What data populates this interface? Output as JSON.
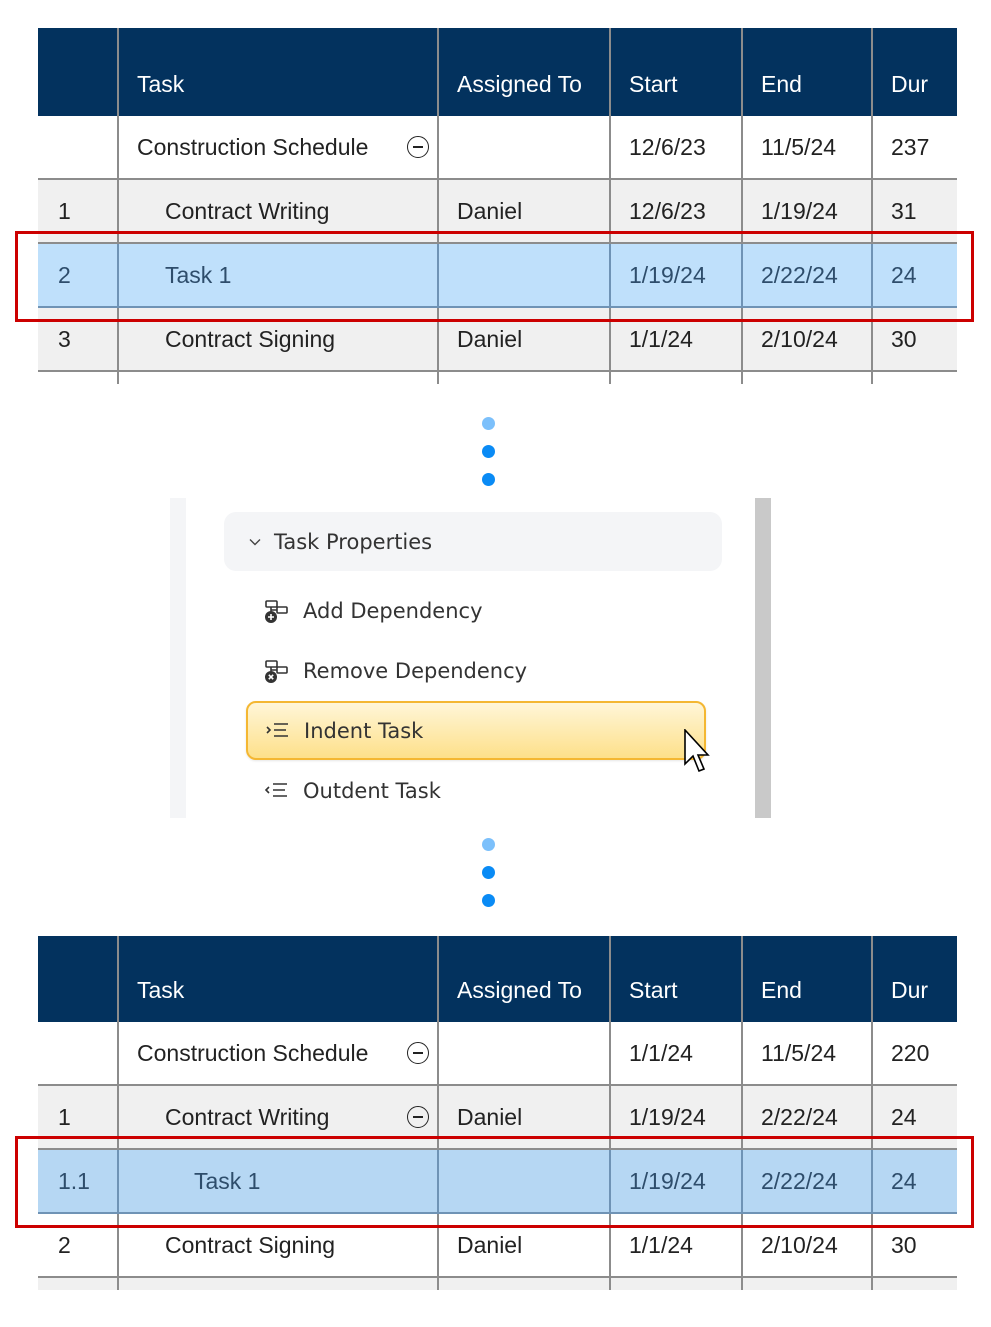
{
  "before": {
    "columns": [
      "",
      "Task",
      "Assigned To",
      "Start",
      "End",
      "Dur"
    ],
    "rows": [
      {
        "id": "",
        "task": "Construction Schedule",
        "assigned": "",
        "start": "12/6/23",
        "end": "11/5/24",
        "dur": "237",
        "collapsible": true
      },
      {
        "id": "1",
        "task": "Contract Writing",
        "assigned": "Daniel",
        "start": "12/6/23",
        "end": "1/19/24",
        "dur": "31"
      },
      {
        "id": "2",
        "task": "Task 1",
        "assigned": "",
        "start": "1/19/24",
        "end": "2/22/24",
        "dur": "24",
        "selected": true
      },
      {
        "id": "3",
        "task": "Contract Signing",
        "assigned": "Daniel",
        "start": "1/1/24",
        "end": "2/10/24",
        "dur": "30"
      }
    ]
  },
  "menu": {
    "section_title": "Task Properties",
    "section_icon": "chevron-down-icon",
    "items": [
      {
        "label": "Add Dependency",
        "icon": "add-dependency-icon"
      },
      {
        "label": "Remove Dependency",
        "icon": "remove-dependency-icon"
      },
      {
        "label": "Indent Task",
        "icon": "indent-icon",
        "hovered": true
      },
      {
        "label": "Outdent Task",
        "icon": "outdent-icon"
      }
    ]
  },
  "after": {
    "columns": [
      "",
      "Task",
      "Assigned To",
      "Start",
      "End",
      "Dur"
    ],
    "rows": [
      {
        "id": "",
        "task": "Construction Schedule",
        "assigned": "",
        "start": "1/1/24",
        "end": "11/5/24",
        "dur": "220",
        "collapsible": true
      },
      {
        "id": "1",
        "task": "Contract Writing",
        "assigned": "Daniel",
        "start": "1/19/24",
        "end": "2/22/24",
        "dur": "24",
        "collapsible": true
      },
      {
        "id": "1.1",
        "task": "Task 1",
        "assigned": "",
        "start": "1/19/24",
        "end": "2/22/24",
        "dur": "24",
        "selected": true
      },
      {
        "id": "2",
        "task": "Contract Signing",
        "assigned": "Daniel",
        "start": "1/1/24",
        "end": "2/10/24",
        "dur": "30"
      }
    ]
  },
  "colors": {
    "header_bg": "#03325e",
    "selected_row": "#bfe0fb",
    "highlight_box": "#cc0000",
    "hover_item": "#fde08a",
    "step_dots": "#0a8bf5"
  }
}
